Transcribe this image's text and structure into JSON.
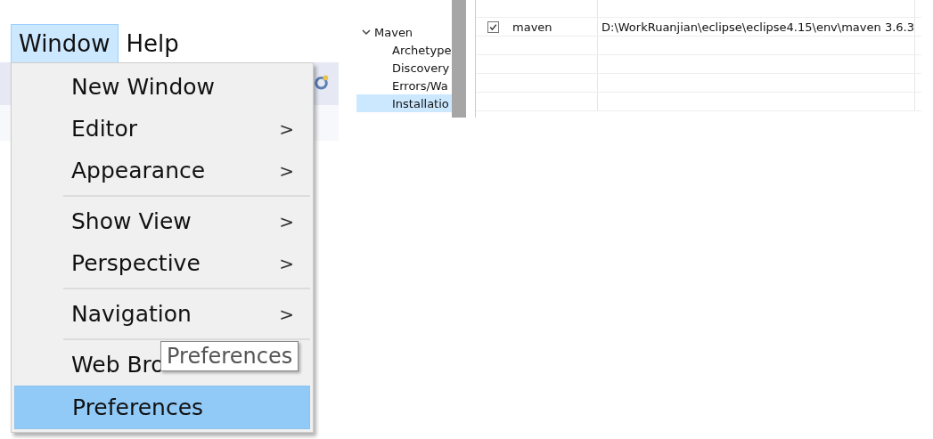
{
  "menu_bar": [
    {
      "label": "Window",
      "selected": true
    },
    {
      "label": "Help",
      "selected": false
    }
  ],
  "menu": [
    {
      "kind": "item",
      "label": "New Window",
      "submenu": false,
      "selected": false
    },
    {
      "kind": "item",
      "label": "Editor",
      "submenu": true,
      "selected": false
    },
    {
      "kind": "item",
      "label": "Appearance",
      "submenu": true,
      "selected": false
    },
    {
      "kind": "separator"
    },
    {
      "kind": "item",
      "label": "Show View",
      "submenu": true,
      "selected": false
    },
    {
      "kind": "item",
      "label": "Perspective",
      "submenu": true,
      "selected": false
    },
    {
      "kind": "separator"
    },
    {
      "kind": "item",
      "label": "Navigation",
      "submenu": true,
      "selected": false
    },
    {
      "kind": "separator"
    },
    {
      "kind": "item",
      "label": "Web Bro",
      "submenu": false,
      "selected": false
    },
    {
      "kind": "item",
      "label": "Preferences",
      "submenu": false,
      "selected": true
    }
  ],
  "submenu_arrow": ">",
  "tooltip": {
    "text": "Preferences"
  },
  "preferences_tree": [
    {
      "label": "Maven",
      "expanded": true,
      "selected": false,
      "children": [
        {
          "label": "Archetype",
          "selected": false
        },
        {
          "label": "Discovery",
          "selected": false
        },
        {
          "label": "Errors/Wa",
          "selected": false
        },
        {
          "label": "Installatio",
          "selected": false,
          "highlighted": true
        }
      ]
    }
  ],
  "installations_table": {
    "rows": [
      {
        "checked": true,
        "name": "maven",
        "location": "D:\\WorkRuanjian\\eclipse\\eclipse4.15\\env\\maven 3.6.3"
      }
    ]
  }
}
